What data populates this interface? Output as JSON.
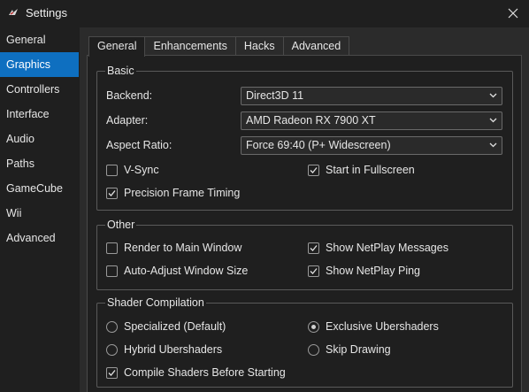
{
  "window": {
    "title": "Settings"
  },
  "sidebar": {
    "items": [
      {
        "label": "General"
      },
      {
        "label": "Graphics"
      },
      {
        "label": "Controllers"
      },
      {
        "label": "Interface"
      },
      {
        "label": "Audio"
      },
      {
        "label": "Paths"
      },
      {
        "label": "GameCube"
      },
      {
        "label": "Wii"
      },
      {
        "label": "Advanced"
      }
    ],
    "selected": "Graphics"
  },
  "tabs": [
    {
      "label": "General"
    },
    {
      "label": "Enhancements"
    },
    {
      "label": "Hacks"
    },
    {
      "label": "Advanced"
    }
  ],
  "active_tab": "General",
  "basic": {
    "title": "Basic",
    "backend": {
      "label": "Backend:",
      "value": "Direct3D 11"
    },
    "adapter": {
      "label": "Adapter:",
      "value": "AMD Radeon RX 7900 XT"
    },
    "aspect": {
      "label": "Aspect Ratio:",
      "value": "Force 69:40 (P+ Widescreen)"
    },
    "vsync": {
      "label": "V-Sync",
      "checked": false
    },
    "fullscreen": {
      "label": "Start in Fullscreen",
      "checked": true
    },
    "precision": {
      "label": "Precision Frame Timing",
      "checked": true
    }
  },
  "other": {
    "title": "Other",
    "render_main": {
      "label": "Render to Main Window",
      "checked": false
    },
    "netplay_messages": {
      "label": "Show NetPlay Messages",
      "checked": true
    },
    "auto_adjust": {
      "label": "Auto-Adjust Window Size",
      "checked": false
    },
    "netplay_ping": {
      "label": "Show NetPlay Ping",
      "checked": true
    }
  },
  "shader": {
    "title": "Shader Compilation",
    "specialized": {
      "label": "Specialized (Default)",
      "selected": false
    },
    "exclusive": {
      "label": "Exclusive Ubershaders",
      "selected": true
    },
    "hybrid": {
      "label": "Hybrid Ubershaders",
      "selected": false
    },
    "skip": {
      "label": "Skip Drawing",
      "selected": false
    },
    "compile_before": {
      "label": "Compile Shaders Before Starting",
      "checked": true
    }
  },
  "colors": {
    "accent": "#0e6fc0",
    "background": "#1f1f1f",
    "panel": "#2b2b2b"
  }
}
